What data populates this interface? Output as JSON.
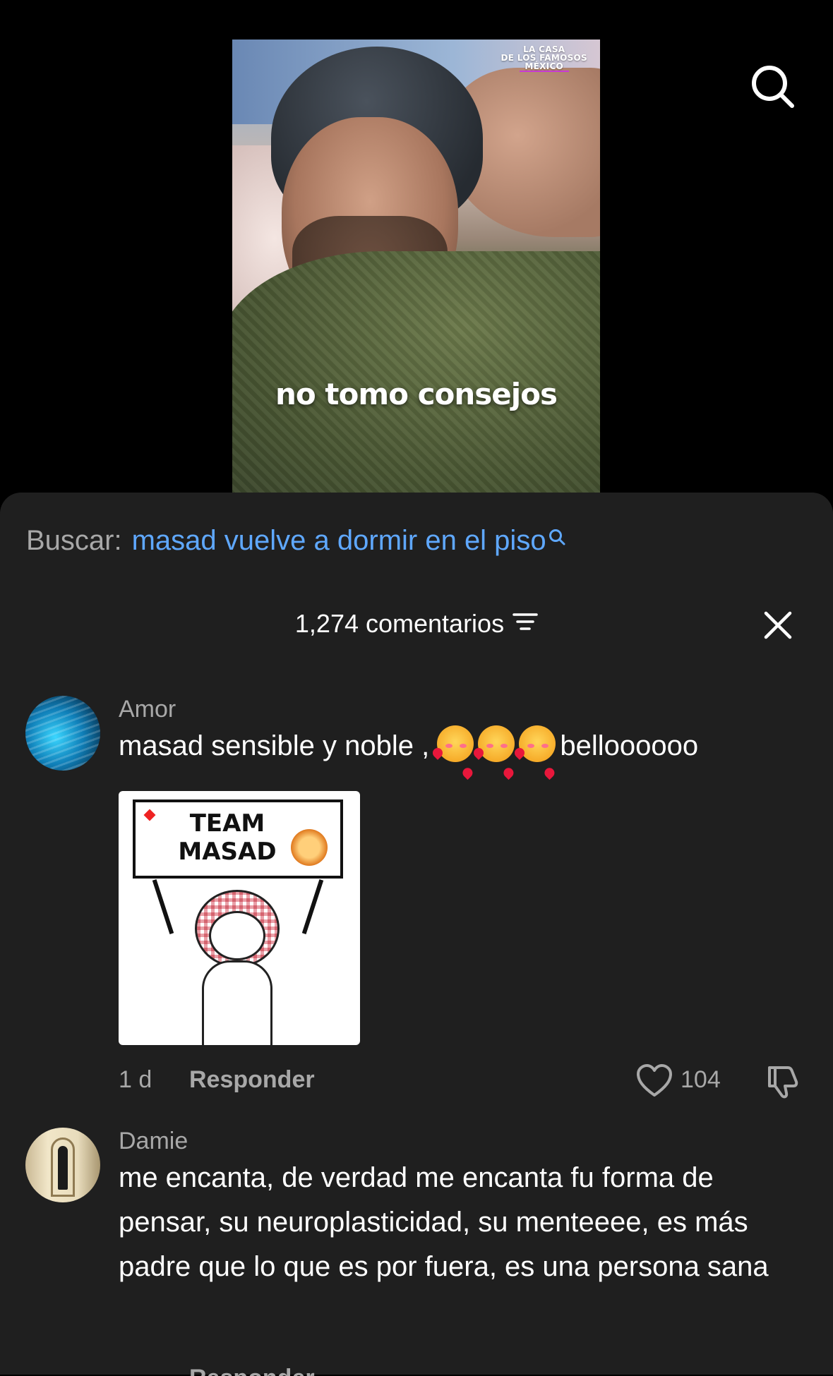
{
  "video": {
    "show_logo": [
      "LA CASA",
      "DE LOS FAMOSOS",
      "MÉXICO"
    ],
    "caption": "no tomo consejos",
    "search_icon": "search-icon"
  },
  "search": {
    "label": "Buscar:",
    "query": "masad vuelve a dormir en el piso",
    "icon": "search-icon"
  },
  "comments_header": {
    "count_label": "1,274 comentarios",
    "filter_icon": "filter-icon",
    "close_icon": "close-icon"
  },
  "comments": [
    {
      "author": "Amor",
      "text_before": "masad sensible y noble , ",
      "text_after": "belloooooo",
      "emoji_count": 3,
      "sticker_lines": [
        "TEAM",
        "MASAD"
      ],
      "time": "1 d",
      "reply_label": "Responder",
      "likes": "104"
    },
    {
      "author": "Damie",
      "text": "me encanta, de verdad me encanta fu forma de pensar, su neuroplasticidad, su menteeee, es más padre que lo que es por fuera, es una persona sana",
      "reply_label": "Responder"
    }
  ],
  "colors": {
    "sheet_bg": "#1f1f1f",
    "link": "#5fa8ff",
    "muted": "#a8a8a8"
  }
}
